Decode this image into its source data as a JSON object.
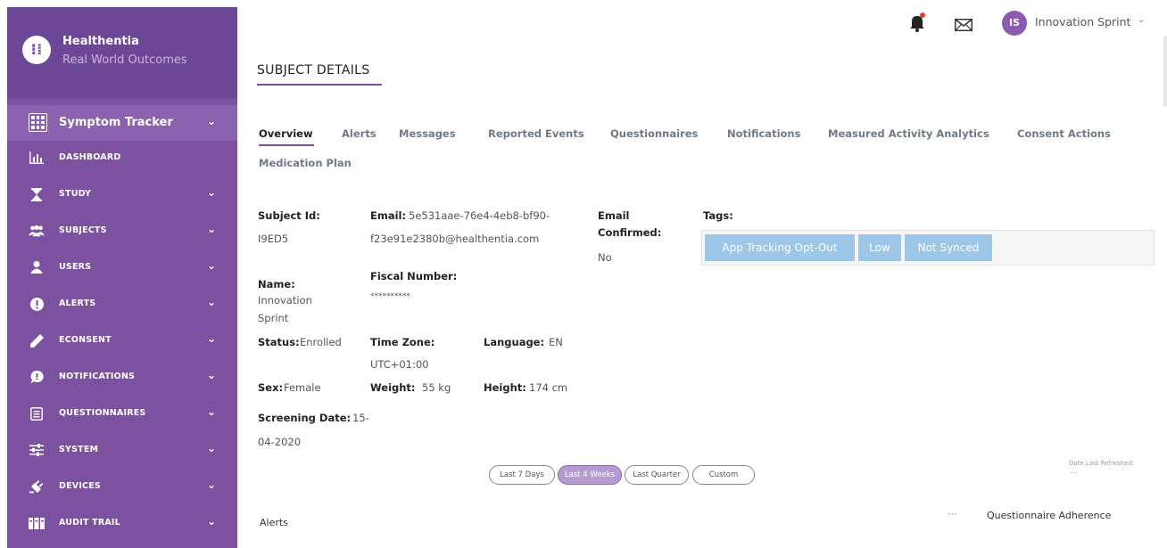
{
  "brand": {
    "logo": "⁝⁞",
    "name": "Healthentia",
    "subtitle": "Real World Outcomes"
  },
  "module": {
    "label": "Symptom Tracker",
    "icon": "grid-icon"
  },
  "sidebar": {
    "items": [
      {
        "label": "DASHBOARD",
        "icon": "bar-chart-icon",
        "expandable": false
      },
      {
        "label": "STUDY",
        "icon": "hourglass-icon",
        "expandable": true
      },
      {
        "label": "SUBJECTS",
        "icon": "people-icon",
        "expandable": true
      },
      {
        "label": "USERS",
        "icon": "user-icon",
        "expandable": true
      },
      {
        "label": "ALERTS",
        "icon": "alert-icon",
        "expandable": true
      },
      {
        "label": "ECONSENT",
        "icon": "pen-icon",
        "expandable": true
      },
      {
        "label": "NOTIFICATIONS",
        "icon": "chat-icon",
        "expandable": true
      },
      {
        "label": "QUESTIONNAIRES",
        "icon": "list-icon",
        "expandable": true
      },
      {
        "label": "SYSTEM",
        "icon": "sliders-icon",
        "expandable": true
      },
      {
        "label": "DEVICES",
        "icon": "plug-icon",
        "expandable": true
      },
      {
        "label": "AUDIT TRAIL",
        "icon": "binders-icon",
        "expandable": true
      }
    ]
  },
  "topbar": {
    "user_initials": "IS",
    "user_name": "Innovation Sprint",
    "chevron": "⌄"
  },
  "page": {
    "title": "SUBJECT DETAILS"
  },
  "tabs": [
    {
      "label": "Overview",
      "active": true
    },
    {
      "label": "Alerts",
      "active": false
    },
    {
      "label": "Messages",
      "active": false
    },
    {
      "label": "Reported Events",
      "active": false
    },
    {
      "label": "Questionnaires",
      "active": false
    },
    {
      "label": "Notifications",
      "active": false
    },
    {
      "label": "Measured Activity Analytics",
      "active": false
    },
    {
      "label": "Consent Actions",
      "active": false
    },
    {
      "label": "Medication Plan",
      "active": false
    }
  ],
  "subject": {
    "id_label": "Subject Id:",
    "id_value": "I9ED5",
    "email_label": "Email:",
    "email_value_line1": "5e531aae-76e4-4eb8-bf90-",
    "email_value_line2": "f23e91e2380b@healthentia.com",
    "email_confirmed_label_line1": "Email",
    "email_confirmed_label_line2": "Confirmed:",
    "email_confirmed_value": "No",
    "tags_label": "Tags:",
    "tags": [
      "App Tracking Opt-Out",
      "Low",
      "Not Synced"
    ],
    "name_label": "Name:",
    "name_value_line1": "Innovation",
    "name_value_line2": "Sprint",
    "fiscal_label": "Fiscal Number:",
    "fiscal_value": "**********",
    "status_label": "Status:",
    "status_value": "Enrolled",
    "timezone_label": "Time Zone:",
    "timezone_value": "UTC+01:00",
    "language_label": "Language:",
    "language_value": "EN",
    "sex_label": "Sex:",
    "sex_value": "Female",
    "weight_label": "Weight:",
    "weight_value": "55 kg",
    "height_label": "Height:",
    "height_value": "174 cm",
    "screening_label": "Screening Date:",
    "screening_value_a": "15-",
    "screening_value_b": "04-2020"
  },
  "ranges": [
    {
      "label": "Last 7 Days",
      "active": false
    },
    {
      "label": "Last 4 Weeks",
      "active": true
    },
    {
      "label": "Last Quarter",
      "active": false
    },
    {
      "label": "Custom",
      "active": false
    }
  ],
  "refreshed": {
    "label": "Date Last Refreshed:"
  },
  "sections": {
    "alerts": "Alerts",
    "questionnaire_adherence": "Questionnaire Adherence"
  },
  "colors": {
    "sidebar": "#7b51a0",
    "sidebar_header": "#6c4796",
    "tag": "#9ec6e6",
    "accent": "#7b51a0",
    "notification_dot": "#e53935"
  }
}
